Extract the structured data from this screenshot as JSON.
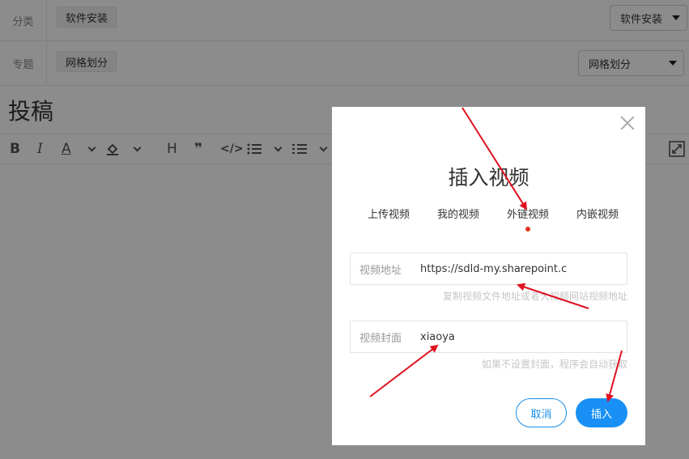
{
  "form": {
    "category": {
      "label": "分类",
      "chip": "软件安装",
      "selected": "软件安装"
    },
    "topic": {
      "label": "专题",
      "chip": "网格划分",
      "selected": "网格划分"
    }
  },
  "page": {
    "title": "投稿"
  },
  "dialog": {
    "title": "插入视频",
    "tabs": [
      {
        "label": "上传视频"
      },
      {
        "label": "我的视频"
      },
      {
        "label": "外链视频",
        "active": true
      },
      {
        "label": "内嵌视频"
      }
    ],
    "url_field": {
      "label": "视频地址",
      "value": "https://sdld-my.sharepoint.c",
      "hint": "复制视频文件地址或者大视频网站视频地址"
    },
    "cover_field": {
      "label": "视频封面",
      "value": "xiaoya",
      "hint": "如果不设置封面，程序会自动获取"
    },
    "cancel_label": "取消",
    "insert_label": "插入"
  },
  "colors": {
    "accent": "#1890f5",
    "active_dot": "#e0321e",
    "arrow": "#e0101e"
  }
}
